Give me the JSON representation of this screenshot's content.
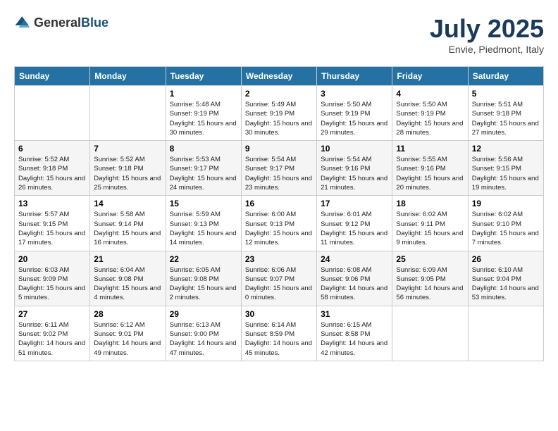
{
  "header": {
    "logo_general": "General",
    "logo_blue": "Blue",
    "month_year": "July 2025",
    "location": "Envie, Piedmont, Italy"
  },
  "days_of_week": [
    "Sunday",
    "Monday",
    "Tuesday",
    "Wednesday",
    "Thursday",
    "Friday",
    "Saturday"
  ],
  "weeks": [
    [
      {
        "day": null,
        "info": null
      },
      {
        "day": null,
        "info": null
      },
      {
        "day": "1",
        "info": "Sunrise: 5:48 AM\nSunset: 9:19 PM\nDaylight: 15 hours\nand 30 minutes."
      },
      {
        "day": "2",
        "info": "Sunrise: 5:49 AM\nSunset: 9:19 PM\nDaylight: 15 hours\nand 30 minutes."
      },
      {
        "day": "3",
        "info": "Sunrise: 5:50 AM\nSunset: 9:19 PM\nDaylight: 15 hours\nand 29 minutes."
      },
      {
        "day": "4",
        "info": "Sunrise: 5:50 AM\nSunset: 9:19 PM\nDaylight: 15 hours\nand 28 minutes."
      },
      {
        "day": "5",
        "info": "Sunrise: 5:51 AM\nSunset: 9:18 PM\nDaylight: 15 hours\nand 27 minutes."
      }
    ],
    [
      {
        "day": "6",
        "info": "Sunrise: 5:52 AM\nSunset: 9:18 PM\nDaylight: 15 hours\nand 26 minutes."
      },
      {
        "day": "7",
        "info": "Sunrise: 5:52 AM\nSunset: 9:18 PM\nDaylight: 15 hours\nand 25 minutes."
      },
      {
        "day": "8",
        "info": "Sunrise: 5:53 AM\nSunset: 9:17 PM\nDaylight: 15 hours\nand 24 minutes."
      },
      {
        "day": "9",
        "info": "Sunrise: 5:54 AM\nSunset: 9:17 PM\nDaylight: 15 hours\nand 23 minutes."
      },
      {
        "day": "10",
        "info": "Sunrise: 5:54 AM\nSunset: 9:16 PM\nDaylight: 15 hours\nand 21 minutes."
      },
      {
        "day": "11",
        "info": "Sunrise: 5:55 AM\nSunset: 9:16 PM\nDaylight: 15 hours\nand 20 minutes."
      },
      {
        "day": "12",
        "info": "Sunrise: 5:56 AM\nSunset: 9:15 PM\nDaylight: 15 hours\nand 19 minutes."
      }
    ],
    [
      {
        "day": "13",
        "info": "Sunrise: 5:57 AM\nSunset: 9:15 PM\nDaylight: 15 hours\nand 17 minutes."
      },
      {
        "day": "14",
        "info": "Sunrise: 5:58 AM\nSunset: 9:14 PM\nDaylight: 15 hours\nand 16 minutes."
      },
      {
        "day": "15",
        "info": "Sunrise: 5:59 AM\nSunset: 9:13 PM\nDaylight: 15 hours\nand 14 minutes."
      },
      {
        "day": "16",
        "info": "Sunrise: 6:00 AM\nSunset: 9:13 PM\nDaylight: 15 hours\nand 12 minutes."
      },
      {
        "day": "17",
        "info": "Sunrise: 6:01 AM\nSunset: 9:12 PM\nDaylight: 15 hours\nand 11 minutes."
      },
      {
        "day": "18",
        "info": "Sunrise: 6:02 AM\nSunset: 9:11 PM\nDaylight: 15 hours\nand 9 minutes."
      },
      {
        "day": "19",
        "info": "Sunrise: 6:02 AM\nSunset: 9:10 PM\nDaylight: 15 hours\nand 7 minutes."
      }
    ],
    [
      {
        "day": "20",
        "info": "Sunrise: 6:03 AM\nSunset: 9:09 PM\nDaylight: 15 hours\nand 5 minutes."
      },
      {
        "day": "21",
        "info": "Sunrise: 6:04 AM\nSunset: 9:08 PM\nDaylight: 15 hours\nand 4 minutes."
      },
      {
        "day": "22",
        "info": "Sunrise: 6:05 AM\nSunset: 9:08 PM\nDaylight: 15 hours\nand 2 minutes."
      },
      {
        "day": "23",
        "info": "Sunrise: 6:06 AM\nSunset: 9:07 PM\nDaylight: 15 hours\nand 0 minutes."
      },
      {
        "day": "24",
        "info": "Sunrise: 6:08 AM\nSunset: 9:06 PM\nDaylight: 14 hours\nand 58 minutes."
      },
      {
        "day": "25",
        "info": "Sunrise: 6:09 AM\nSunset: 9:05 PM\nDaylight: 14 hours\nand 56 minutes."
      },
      {
        "day": "26",
        "info": "Sunrise: 6:10 AM\nSunset: 9:04 PM\nDaylight: 14 hours\nand 53 minutes."
      }
    ],
    [
      {
        "day": "27",
        "info": "Sunrise: 6:11 AM\nSunset: 9:02 PM\nDaylight: 14 hours\nand 51 minutes."
      },
      {
        "day": "28",
        "info": "Sunrise: 6:12 AM\nSunset: 9:01 PM\nDaylight: 14 hours\nand 49 minutes."
      },
      {
        "day": "29",
        "info": "Sunrise: 6:13 AM\nSunset: 9:00 PM\nDaylight: 14 hours\nand 47 minutes."
      },
      {
        "day": "30",
        "info": "Sunrise: 6:14 AM\nSunset: 8:59 PM\nDaylight: 14 hours\nand 45 minutes."
      },
      {
        "day": "31",
        "info": "Sunrise: 6:15 AM\nSunset: 8:58 PM\nDaylight: 14 hours\nand 42 minutes."
      },
      {
        "day": null,
        "info": null
      },
      {
        "day": null,
        "info": null
      }
    ]
  ]
}
